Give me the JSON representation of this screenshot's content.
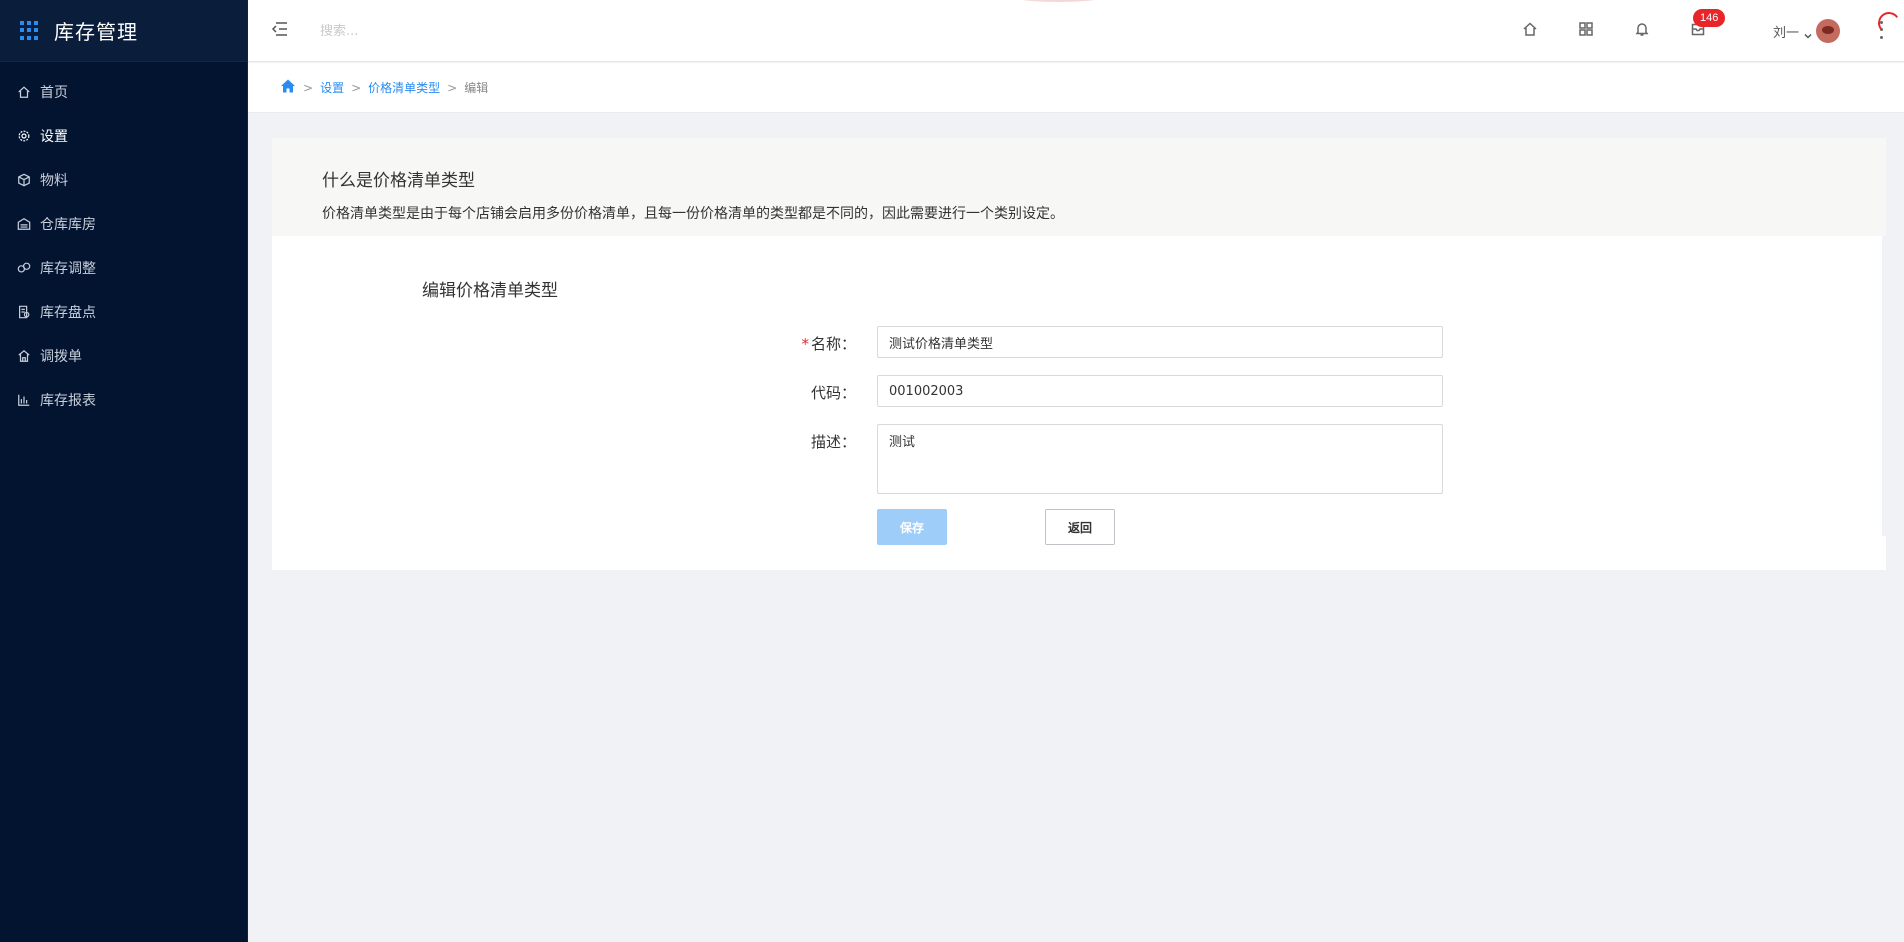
{
  "app": {
    "title": "库存管理"
  },
  "sidebar": {
    "items": [
      {
        "label": "首页",
        "icon": "home-icon",
        "active": false
      },
      {
        "label": "设置",
        "icon": "gear-icon",
        "active": true
      },
      {
        "label": "物料",
        "icon": "box-icon",
        "active": false
      },
      {
        "label": "仓库库房",
        "icon": "warehouse-icon",
        "active": false
      },
      {
        "label": "库存调整",
        "icon": "adjust-icon",
        "active": false
      },
      {
        "label": "库存盘点",
        "icon": "inventory-check-icon",
        "active": false
      },
      {
        "label": "调拨单",
        "icon": "transfer-icon",
        "active": false
      },
      {
        "label": "库存报表",
        "icon": "bar-chart-icon",
        "active": false
      }
    ]
  },
  "header": {
    "search_placeholder": "搜索...",
    "notification_count": "146",
    "user_name": "刘一"
  },
  "breadcrumb": {
    "items": [
      "设置",
      "价格清单类型"
    ],
    "current": "编辑",
    "separator": ">"
  },
  "intro": {
    "title": "什么是价格清单类型",
    "description": "价格清单类型是由于每个店铺会启用多份价格清单，且每一份价格清单的类型都是不同的，因此需要进行一个类别设定。"
  },
  "form": {
    "title": "编辑价格清单类型",
    "name_label": "名称：",
    "name_value": "测试价格清单类型",
    "code_label": "代码：",
    "code_value": "001002003",
    "desc_label": "描述：",
    "desc_value": "测试",
    "required_mark": "*",
    "save_label": "保存",
    "back_label": "返回"
  },
  "colors": {
    "sidebar_bg": "#031431",
    "accent": "#2a8cf0",
    "badge": "#e8262a",
    "save_disabled": "#9fcdfa"
  }
}
